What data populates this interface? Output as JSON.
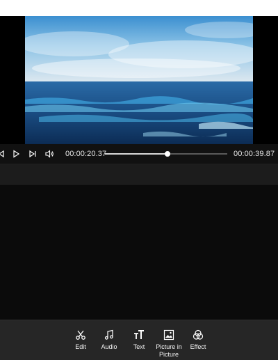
{
  "player": {
    "current_time": "00:00:20.37",
    "total_time": "00:00:39.87",
    "progress": 0.51
  },
  "toolbar": {
    "items": [
      {
        "label": "Edit",
        "icon": "scissors-icon"
      },
      {
        "label": "Audio",
        "icon": "music-note-icon"
      },
      {
        "label": "Text",
        "icon": "text-icon"
      },
      {
        "label": "Picture in Picture",
        "icon": "picture-icon"
      },
      {
        "label": "Effect",
        "icon": "effect-icon"
      }
    ]
  },
  "colors": {
    "background": "#0e0e0e",
    "toolbar": "#262626",
    "ocean": "#1f5f9a",
    "sky": "#8fc4e6"
  }
}
